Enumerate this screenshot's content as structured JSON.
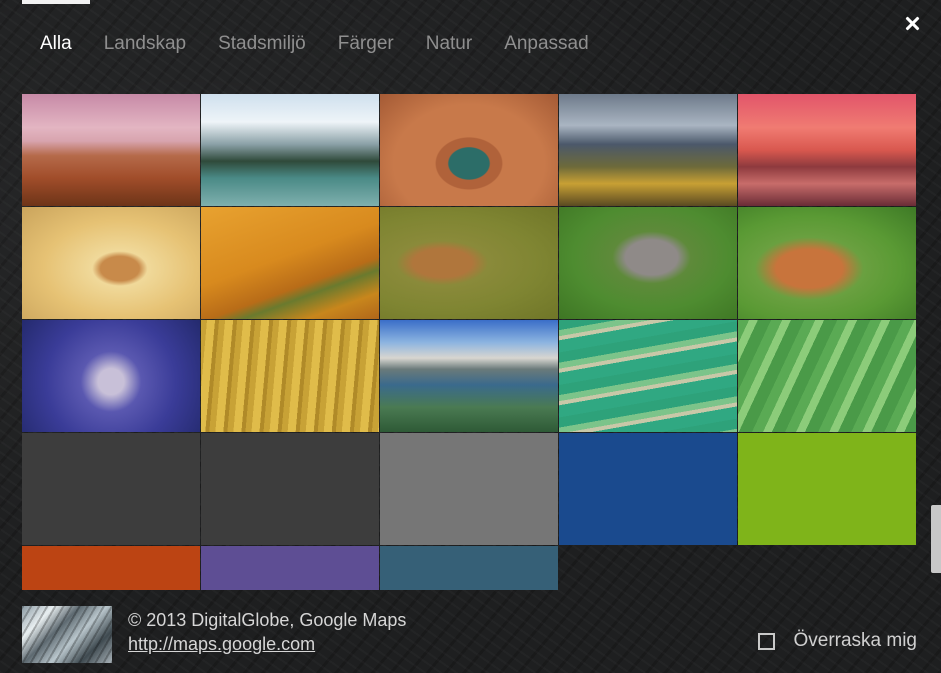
{
  "tabs": [
    {
      "label": "Alla",
      "active": true
    },
    {
      "label": "Landskap",
      "active": false
    },
    {
      "label": "Stadsmiljö",
      "active": false
    },
    {
      "label": "Färger",
      "active": false
    },
    {
      "label": "Natur",
      "active": false
    },
    {
      "label": "Anpassad",
      "active": false
    }
  ],
  "close_icon": "close-icon",
  "wallpapers": [
    {
      "name": "desert-mountains-sunset",
      "kind": "photo"
    },
    {
      "name": "alpine-lake-forest",
      "kind": "photo"
    },
    {
      "name": "horseshoe-bend-canyon",
      "kind": "photo"
    },
    {
      "name": "mountains-autumn-trees",
      "kind": "photo"
    },
    {
      "name": "bridge-pink-sunset",
      "kind": "photo"
    },
    {
      "name": "frog-in-sand",
      "kind": "photo"
    },
    {
      "name": "bird-on-branch",
      "kind": "photo"
    },
    {
      "name": "owl-in-flight",
      "kind": "photo"
    },
    {
      "name": "baby-elephant",
      "kind": "photo"
    },
    {
      "name": "fox-in-grass",
      "kind": "photo"
    },
    {
      "name": "blue-mushrooms",
      "kind": "photo"
    },
    {
      "name": "golden-grass-butterfly",
      "kind": "photo"
    },
    {
      "name": "clear-mountain-lake",
      "kind": "photo"
    },
    {
      "name": "green-terraced-fields",
      "kind": "photo"
    },
    {
      "name": "green-grass-blades",
      "kind": "photo"
    },
    {
      "name": "solid-dark-gray",
      "kind": "solid",
      "color": "#3d3d3d"
    },
    {
      "name": "solid-dark-gray-2",
      "kind": "solid",
      "color": "#3d3d3d"
    },
    {
      "name": "solid-gray",
      "kind": "solid",
      "color": "#767676"
    },
    {
      "name": "solid-blue",
      "kind": "solid",
      "color": "#1a4a8e"
    },
    {
      "name": "solid-lime-green",
      "kind": "solid",
      "color": "#7fb41a"
    },
    {
      "name": "solid-orange",
      "kind": "solid",
      "color": "#bc4413"
    },
    {
      "name": "solid-purple",
      "kind": "solid",
      "color": "#5e4e94"
    },
    {
      "name": "solid-slate-blue",
      "kind": "solid",
      "color": "#366077"
    }
  ],
  "footer": {
    "credit": "© 2013 DigitalGlobe, Google Maps",
    "link": "http://maps.google.com",
    "surprise_label": "Överraska mig",
    "surprise_checked": false
  }
}
